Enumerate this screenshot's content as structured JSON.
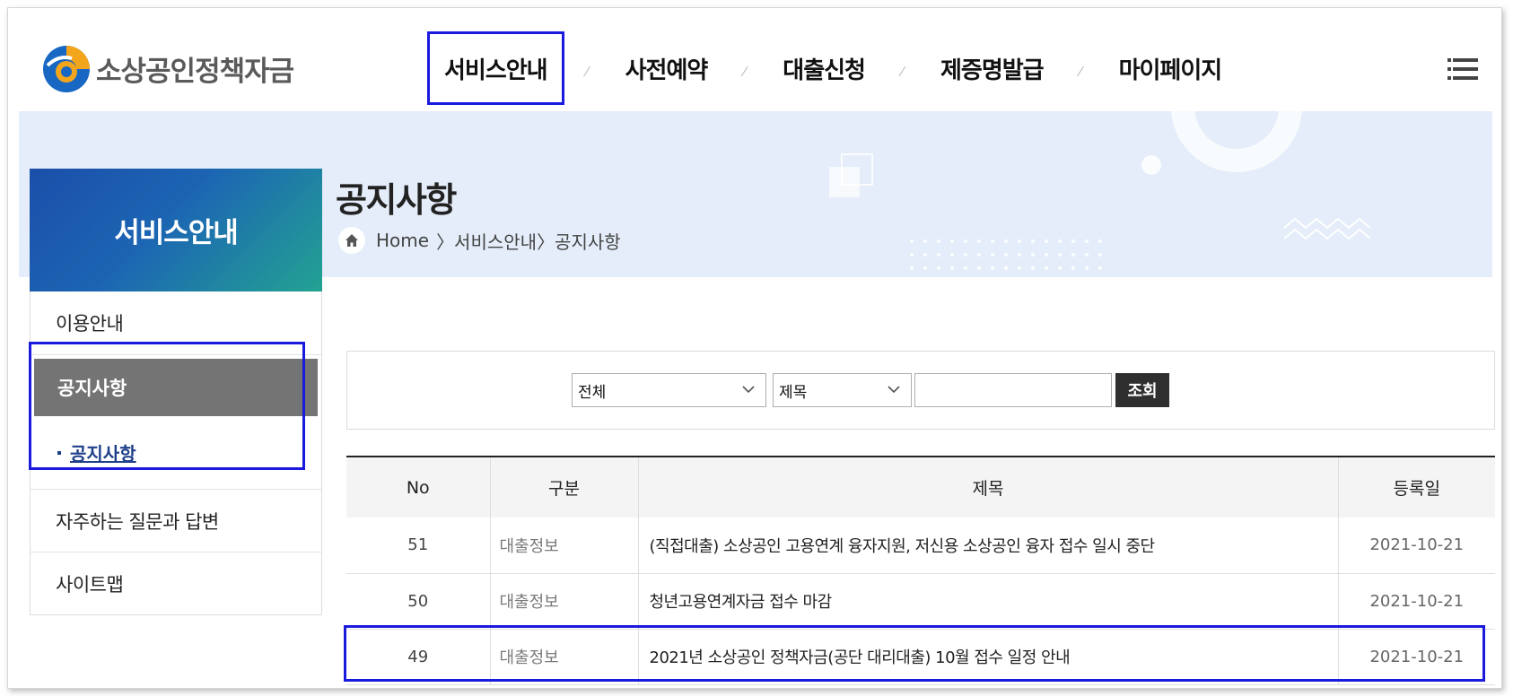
{
  "logo": {
    "text": "소상공인정책자금"
  },
  "gnb": {
    "items": [
      {
        "label": "서비스안내"
      },
      {
        "label": "사전예약"
      },
      {
        "label": "대출신청"
      },
      {
        "label": "제증명발급"
      },
      {
        "label": "마이페이지"
      }
    ]
  },
  "visual": {
    "title": "공지사항",
    "breadcrumb": {
      "home": "Home",
      "level1": "〉서비스안내",
      "level2": "〉공지사항"
    }
  },
  "sidebar": {
    "title": "서비스안내",
    "items": [
      {
        "label": "이용안내"
      },
      {
        "label": "공지사항"
      },
      {
        "label": "자주하는 질문과 답변"
      },
      {
        "label": "사이트맵"
      }
    ],
    "sub_items": [
      {
        "label": "공지사항"
      }
    ]
  },
  "search": {
    "select1": "전체",
    "select2": "제목",
    "input_value": "",
    "button": "조회"
  },
  "table": {
    "headers": {
      "no": "No",
      "category": "구분",
      "title": "제목",
      "date": "등록일"
    },
    "rows": [
      {
        "no": "51",
        "category": "대출정보",
        "title": "(직접대출) 소상공인 고용연계 융자지원, 저신용 소상공인 융자 접수 일시 중단",
        "date": "2021-10-21"
      },
      {
        "no": "50",
        "category": "대출정보",
        "title": "청년고용연계자금 접수 마감",
        "date": "2021-10-21"
      },
      {
        "no": "49",
        "category": "대출정보",
        "title": "2021년 소상공인 정책자금(공단 대리대출) 10월 접수 일정 안내",
        "date": "2021-10-21"
      }
    ]
  },
  "colors": {
    "highlight": "#1a1adf",
    "lnb_active": "#747474",
    "banner": "#e4edf9"
  },
  "icons": {
    "menu": "hamburger-icon",
    "home": "home-icon",
    "dropdown": "chevron-down-icon"
  }
}
